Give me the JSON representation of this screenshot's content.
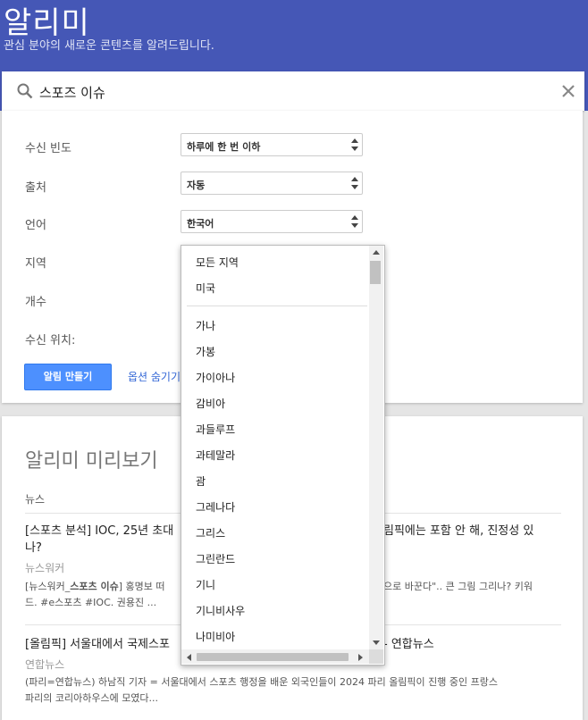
{
  "header": {
    "title": "알리미",
    "subtitle": "관심 분야의 새로운 콘텐츠를 알려드립니다."
  },
  "search": {
    "value": "스포즈 이슈"
  },
  "options": {
    "frequency_label": "수신 빈도",
    "frequency_value": "하루에 한 번 이하",
    "source_label": "출처",
    "source_value": "자동",
    "language_label": "언어",
    "language_value": "한국어",
    "region_label": "지역",
    "count_label": "개수",
    "deliver_label": "수신 위치:",
    "create_button": "알림 만들기",
    "hide_options": "옵션 숨기기"
  },
  "region_dropdown": {
    "top_options": [
      "모든 지역",
      "미국"
    ],
    "options": [
      "가나",
      "가봉",
      "가이아나",
      "감비아",
      "과들루프",
      "과테말라",
      "괌",
      "그레나다",
      "그리스",
      "그린란드",
      "기니",
      "기니비사우",
      "나미비아"
    ]
  },
  "preview": {
    "title": "알리미 미리보기",
    "section": "뉴스",
    "items": [
      {
        "title_left": "[스포츠 분석] IOC, 25년 초대",
        "title_right": "림픽에는 포함 안 해, 진정성 있",
        "title_line2": "나?",
        "source": "뉴스워커",
        "snippet_left_pre": "[뉴스워커_",
        "snippet_bold": "스포츠 이슈",
        "snippet_left_post": "] 홍명보 떠",
        "snippet_right": "으로 바꾼다\".. 큰 그림 그리나? 키워",
        "snippet_line2": "드. #e스포츠 #IOC. 권용진 ..."
      },
      {
        "title_left": "[올림픽] 서울대에서 국제스포",
        "title_right": "- 연합뉴스",
        "source": "연합뉴스",
        "snippet_line1": "(파리=연합뉴스) 하남직 기자 = 서울대에서 스포츠 행정을 배운 외국인들이 2024 파리 올림픽이 진행 중인 프랑스",
        "snippet_line2": "파리의 코리아하우스에 모였다..."
      }
    ]
  }
}
